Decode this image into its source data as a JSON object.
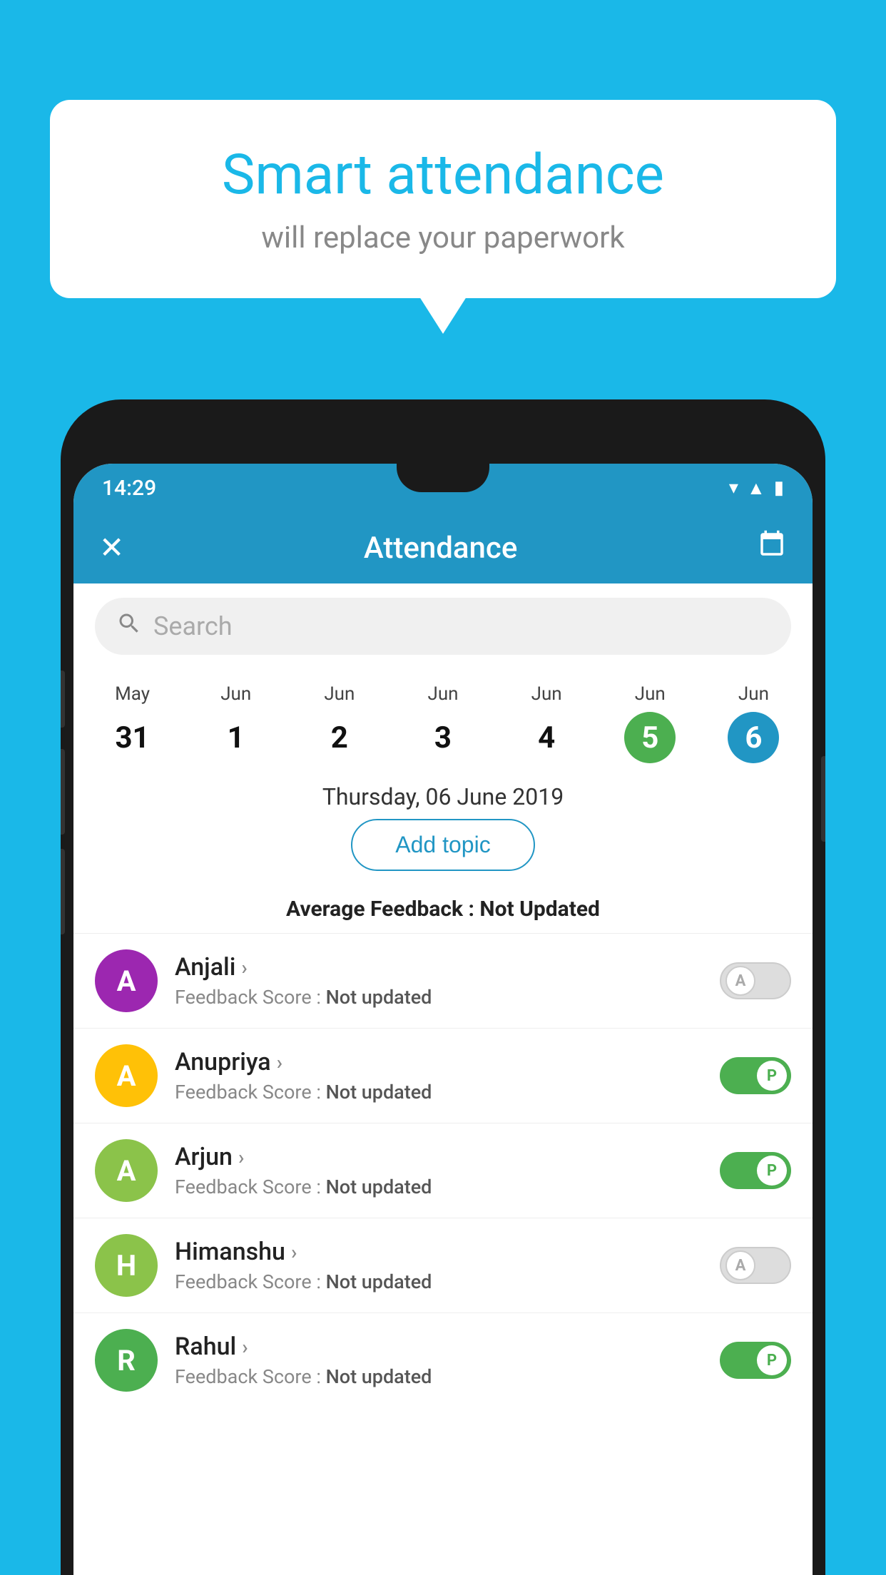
{
  "background_color": "#1ab8e8",
  "speech_bubble": {
    "title": "Smart attendance",
    "subtitle": "will replace your paperwork"
  },
  "status_bar": {
    "time": "14:29",
    "icons": [
      "wifi",
      "signal",
      "battery"
    ]
  },
  "app_bar": {
    "title": "Attendance",
    "close_label": "✕",
    "calendar_label": "📅"
  },
  "search": {
    "placeholder": "Search"
  },
  "calendar": {
    "days": [
      {
        "month": "May",
        "date": "31",
        "state": "normal"
      },
      {
        "month": "Jun",
        "date": "1",
        "state": "normal"
      },
      {
        "month": "Jun",
        "date": "2",
        "state": "normal"
      },
      {
        "month": "Jun",
        "date": "3",
        "state": "normal"
      },
      {
        "month": "Jun",
        "date": "4",
        "state": "normal"
      },
      {
        "month": "Jun",
        "date": "5",
        "state": "today"
      },
      {
        "month": "Jun",
        "date": "6",
        "state": "selected"
      }
    ],
    "selected_date_label": "Thursday, 06 June 2019"
  },
  "add_topic_button": "Add topic",
  "average_feedback": {
    "label": "Average Feedback :",
    "value": "Not Updated"
  },
  "students": [
    {
      "name": "Anjali",
      "avatar_letter": "A",
      "avatar_color": "#9c27b0",
      "feedback": "Not updated",
      "toggle_state": "off",
      "toggle_letter": "A"
    },
    {
      "name": "Anupriya",
      "avatar_letter": "A",
      "avatar_color": "#ffc107",
      "feedback": "Not updated",
      "toggle_state": "on",
      "toggle_letter": "P"
    },
    {
      "name": "Arjun",
      "avatar_letter": "A",
      "avatar_color": "#8bc34a",
      "feedback": "Not updated",
      "toggle_state": "on",
      "toggle_letter": "P"
    },
    {
      "name": "Himanshu",
      "avatar_letter": "H",
      "avatar_color": "#8bc34a",
      "feedback": "Not updated",
      "toggle_state": "off",
      "toggle_letter": "A"
    },
    {
      "name": "Rahul",
      "avatar_letter": "R",
      "avatar_color": "#4caf50",
      "feedback": "Not updated",
      "toggle_state": "on",
      "toggle_letter": "P"
    }
  ]
}
